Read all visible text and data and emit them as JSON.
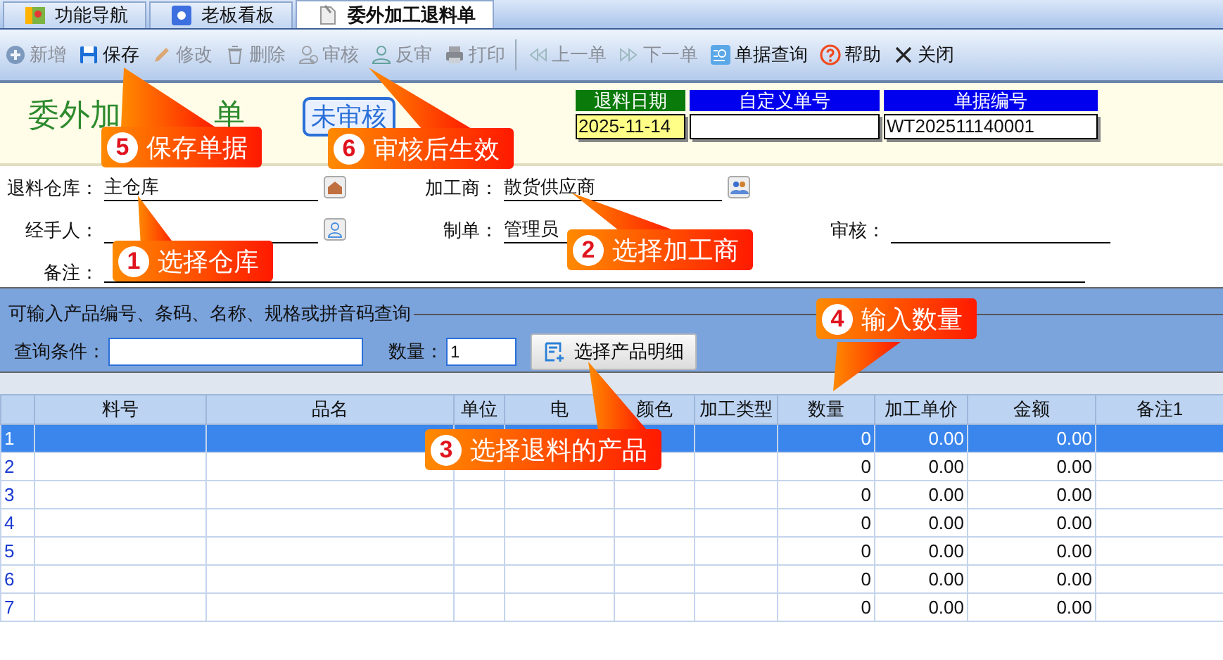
{
  "tabs": [
    {
      "label": "功能导航",
      "selected": false
    },
    {
      "label": "老板看板",
      "selected": false
    },
    {
      "label": "委外加工退料单",
      "selected": true
    }
  ],
  "toolbar": [
    {
      "label": "新增",
      "disabled": true,
      "separator_before": false
    },
    {
      "label": "保存",
      "disabled": false,
      "separator_before": false
    },
    {
      "label": "修改",
      "disabled": true,
      "separator_before": false
    },
    {
      "label": "删除",
      "disabled": true,
      "separator_before": false
    },
    {
      "label": "审核",
      "disabled": true,
      "separator_before": false
    },
    {
      "label": "反审",
      "disabled": true,
      "separator_before": false
    },
    {
      "label": "打印",
      "disabled": true,
      "separator_before": false
    },
    {
      "label": "上一单",
      "disabled": true,
      "separator_before": true
    },
    {
      "label": "下一单",
      "disabled": true,
      "separator_before": false
    },
    {
      "label": "单据查询",
      "disabled": false,
      "separator_before": false
    },
    {
      "label": "帮助",
      "disabled": false,
      "separator_before": false
    },
    {
      "label": "关闭",
      "disabled": false,
      "separator_before": false
    }
  ],
  "document": {
    "title_parts": [
      "委外加",
      "单"
    ],
    "status": "未审核",
    "fields": [
      {
        "label": "退料日期",
        "value": "2025-11-14",
        "kind": "date"
      },
      {
        "label": "自定义单号",
        "kind": "text"
      },
      {
        "label": "单据编号",
        "value": "WT202511140001",
        "kind": "text"
      }
    ]
  },
  "form": {
    "warehouse": {
      "label": "退料仓库：",
      "value": "主仓库"
    },
    "processor": {
      "label": "加工商：",
      "value": "散货供应商"
    },
    "handler": {
      "label": "经手人："
    },
    "creator": {
      "label": "制单：",
      "value": "管理员"
    },
    "auditor": {
      "label": "审核："
    },
    "remark": {
      "label": "备注："
    }
  },
  "search": {
    "hint": "可输入产品编号、条码、名称、规格或拼音码查询",
    "query_label": "查询条件：",
    "qty_label": "数量：",
    "qty_value": "1",
    "button": "选择产品明细"
  },
  "table": {
    "columns": [
      "料号",
      "品名",
      "单位",
      "电",
      "颜色",
      "加工类型",
      "数量",
      "加工单价",
      "金额",
      "备注1"
    ],
    "rows": [
      {
        "no": "1",
        "qty": "0",
        "price": "0.00",
        "amount": "0.00",
        "selected": true
      },
      {
        "no": "2",
        "qty": "0",
        "price": "0.00",
        "amount": "0.00",
        "selected": false
      },
      {
        "no": "3",
        "qty": "0",
        "price": "0.00",
        "amount": "0.00",
        "selected": false
      },
      {
        "no": "4",
        "qty": "0",
        "price": "0.00",
        "amount": "0.00",
        "selected": false
      },
      {
        "no": "5",
        "qty": "0",
        "price": "0.00",
        "amount": "0.00",
        "selected": false
      },
      {
        "no": "6",
        "qty": "0",
        "price": "0.00",
        "amount": "0.00",
        "selected": false
      },
      {
        "no": "7",
        "qty": "0",
        "price": "0.00",
        "amount": "0.00",
        "selected": false
      }
    ]
  },
  "callouts": [
    {
      "number": "5",
      "text": "保存单据"
    },
    {
      "number": "6",
      "text": "审核后生效"
    },
    {
      "number": "1",
      "text": "选择仓库"
    },
    {
      "number": "2",
      "text": "选择加工商"
    },
    {
      "number": "3",
      "text": "选择退料的产品"
    },
    {
      "number": "4",
      "text": "输入数量"
    }
  ]
}
